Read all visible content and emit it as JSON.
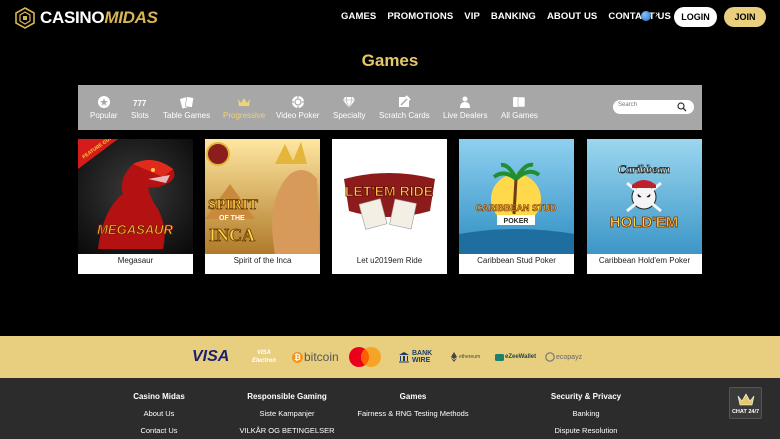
{
  "header": {
    "logo_casino": "CASINO",
    "logo_midas": "MIDAS",
    "nav": [
      "GAMES",
      "PROMOTIONS",
      "VIP",
      "BANKING",
      "ABOUT US",
      "CONTACT US"
    ],
    "login_label": "LOGIN",
    "join_label": "JOIN"
  },
  "title": "Games",
  "categories": [
    {
      "label": "Popular",
      "icon": "star-icon"
    },
    {
      "label": "Slots",
      "icon": "slots-777-icon"
    },
    {
      "label": "Table Games",
      "icon": "cards-icon"
    },
    {
      "label": "Progressive",
      "icon": "crown-icon",
      "active": true
    },
    {
      "label": "Video Poker",
      "icon": "poker-chip-icon"
    },
    {
      "label": "Specialty",
      "icon": "diamond-icon"
    },
    {
      "label": "Scratch Cards",
      "icon": "scratch-card-icon"
    },
    {
      "label": "Live Dealers",
      "icon": "dealer-icon"
    },
    {
      "label": "All Games",
      "icon": "all-cards-icon"
    }
  ],
  "search": {
    "placeholder": "Search"
  },
  "games": [
    {
      "name": "Megasaur",
      "art_text": "MEGASAUR",
      "badge": "FEATURE GUARANTEE"
    },
    {
      "name": "Spirit of the Inca",
      "art_line1": "SPIRIT",
      "art_line2": "OF THE",
      "art_line3": "INCA"
    },
    {
      "name": "Let u2019em Ride",
      "art_text": "LET'EM RIDE"
    },
    {
      "name": "Caribbean Stud Poker",
      "art_line1": "CARIBBEAN STUD",
      "art_line2": "POKER"
    },
    {
      "name": "Caribbean Hold'em Poker",
      "art_line1": "Caribbean",
      "art_line2": "HOLD'EM"
    }
  ],
  "payments": {
    "visa": "VISA",
    "visa_electron_1": "VISA",
    "visa_electron_2": "Electron",
    "bitcoin": "bitcoin",
    "bankwire_1": "BANK",
    "bankwire_2": "WIRE",
    "ethereum": "ethereum",
    "ezeewallet": "eZeeWallet",
    "ecopayz": "ecopayz"
  },
  "footer": {
    "col1": {
      "head": "Casino Midas",
      "links": [
        "About Us",
        "Contact Us"
      ]
    },
    "col2": {
      "head": "Responsible Gaming",
      "links": [
        "Siste Kampanjer",
        "VILKÅR OG BETINGELSER"
      ]
    },
    "col3": {
      "head": "Games",
      "links": [
        "Fairness & RNG Testing Methods"
      ]
    },
    "col4": {
      "head": "Security & Privacy",
      "links": [
        "Banking",
        "Dispute Resolution"
      ]
    }
  },
  "chat_label": "CHAT 24/7",
  "colors": {
    "accent": "#e6c86b",
    "gold_strip": "#e8cf80",
    "catbar": "#a7a7a7",
    "footer": "#2c2c2c"
  }
}
